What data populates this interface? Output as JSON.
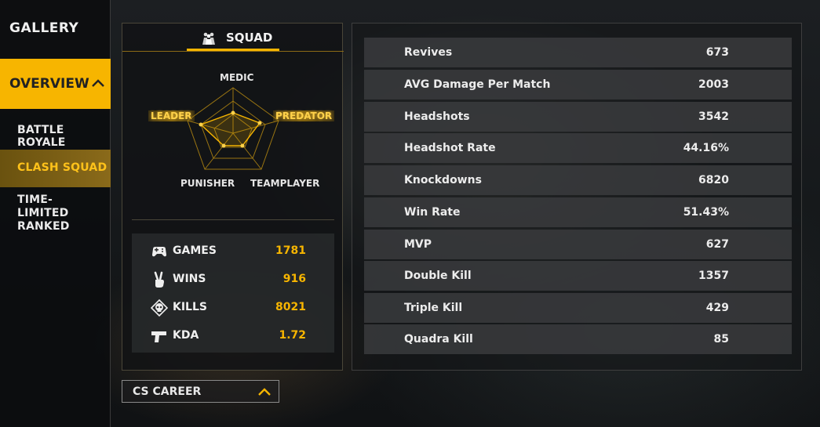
{
  "sidebar": {
    "gallery": "GALLERY",
    "overview": "OVERVIEW",
    "items": [
      {
        "label": "BATTLE ROYALE"
      },
      {
        "label": "CLASH SQUAD"
      },
      {
        "label": "TIME-LIMITED RANKED"
      }
    ],
    "active_index": 1
  },
  "squad": {
    "title": "SQUAD",
    "radar_labels": {
      "top": "MEDIC",
      "left": "LEADER",
      "right": "PREDATOR",
      "bottom_left": "PUNISHER",
      "bottom_right": "TEAMPLAYER"
    },
    "highlighted_labels": [
      "LEADER",
      "PREDATOR"
    ],
    "stats": [
      {
        "icon": "gamepad-icon",
        "label": "GAMES",
        "value": "1781"
      },
      {
        "icon": "victory-hand-icon",
        "label": "WINS",
        "value": "916"
      },
      {
        "icon": "skull-icon",
        "label": "KILLS",
        "value": "8021"
      },
      {
        "icon": "pistol-icon",
        "label": "KDA",
        "value": "1.72"
      }
    ]
  },
  "career_dropdown": {
    "label": "CS CAREER"
  },
  "details": [
    {
      "label": "Revives",
      "value": "673"
    },
    {
      "label": "AVG Damage Per Match",
      "value": "2003"
    },
    {
      "label": "Headshots",
      "value": "3542"
    },
    {
      "label": "Headshot Rate",
      "value": "44.16%"
    },
    {
      "label": "Knockdowns",
      "value": "6820"
    },
    {
      "label": "Win Rate",
      "value": "51.43%"
    },
    {
      "label": "MVP",
      "value": "627"
    },
    {
      "label": "Double Kill",
      "value": "1357"
    },
    {
      "label": "Triple Kill",
      "value": "429"
    },
    {
      "label": "Quadra Kill",
      "value": "85"
    }
  ],
  "colors": {
    "accent": "#f7b500",
    "active_bg": "#8a6a1a",
    "row_bg": "#3a3c3e"
  }
}
